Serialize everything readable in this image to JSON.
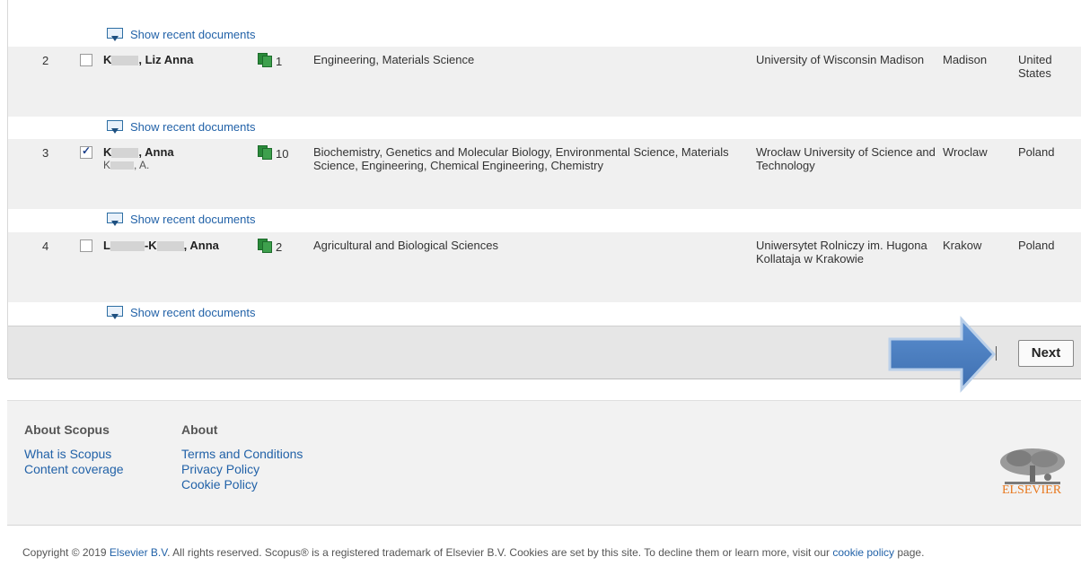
{
  "show_docs_label": "Show recent documents",
  "rows": [
    {
      "num": "2",
      "checked": false,
      "name_prefix": "K",
      "name_suffix": ", Liz Anna",
      "alt": "",
      "docs": "1",
      "subjects": "Engineering, Materials Science",
      "affiliation": "University of Wisconsin Madison",
      "city": "Madison",
      "country": "United States"
    },
    {
      "num": "3",
      "checked": true,
      "name_prefix": "K",
      "name_suffix": ", Anna",
      "alt_prefix": "K",
      "alt_suffix": ", A.",
      "docs": "10",
      "subjects": "Biochemistry, Genetics and Molecular Biology, Environmental Science, Materials Science, Engineering, Chemical Engineering, Chemistry",
      "affiliation": "Wrocław University of Science and Technology",
      "city": "Wroclaw",
      "country": "Poland"
    },
    {
      "num": "4",
      "checked": false,
      "name_prefix": "L",
      "name_mid": "-K",
      "name_suffix": ", Anna",
      "alt": "",
      "docs": "2",
      "subjects": "Agricultural and Biological Sciences",
      "affiliation": "Uniwersytet Rolniczy im. Hugona Kollataja w Krakowie",
      "city": "Krakow",
      "country": "Poland"
    }
  ],
  "pager": {
    "next_label": "Next"
  },
  "footer": {
    "col1": {
      "heading": "About Scopus",
      "links": [
        "What is Scopus",
        "Content coverage"
      ]
    },
    "col2": {
      "heading": "About",
      "links": [
        "Terms and Conditions",
        "Privacy Policy",
        "Cookie Policy"
      ]
    },
    "logo_text": "ELSEVIER"
  },
  "copyright": {
    "part1": "Copyright © 2019 ",
    "elsevier_link": "Elsevier B.V",
    "part2": ". All rights reserved. Scopus® is a registered trademark of Elsevier B.V. Cookies are set by this site. To decline them or learn more, visit our ",
    "cookie_link": "cookie policy",
    "part3": " page."
  },
  "colors": {
    "link": "#2262a8",
    "row_bg": "#f0f0f0",
    "arrow": "#4a7fc1",
    "logo": "#e8781e"
  }
}
